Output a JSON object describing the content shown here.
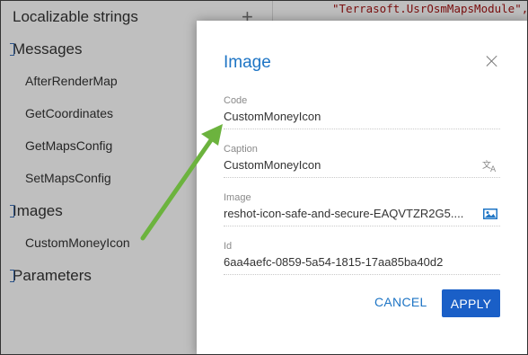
{
  "tree": {
    "localizable": "Localizable strings",
    "messages": "Messages",
    "msg_items": [
      "AfterRenderMap",
      "GetCoordinates",
      "GetMapsConfig",
      "SetMapsConfig"
    ],
    "images": "Images",
    "image_items": [
      "CustomMoneyIcon"
    ],
    "parameters": "Parameters",
    "add_symbol": "+"
  },
  "code": {
    "text": "\"Terrasoft.UsrOsmMapsModule\","
  },
  "dialog": {
    "title": "Image",
    "fields": {
      "code": {
        "label": "Code",
        "value": "CustomMoneyIcon"
      },
      "caption": {
        "label": "Caption",
        "value": "CustomMoneyIcon"
      },
      "image": {
        "label": "Image",
        "value": "reshot-icon-safe-and-secure-EAQVTZR2G5...."
      },
      "id": {
        "label": "Id",
        "value": "6aa4aefc-0859-5a54-1815-17aa85ba40d2"
      }
    },
    "cancel_label": "CANCEL",
    "apply_label": "APPLY"
  },
  "colors": {
    "accent": "#1e75c5",
    "apply_bg": "#1a5fc7",
    "arrow": "#6cb33e"
  },
  "icons": [
    "close-icon",
    "translate-icon",
    "image-icon",
    "annotation-arrow"
  ]
}
